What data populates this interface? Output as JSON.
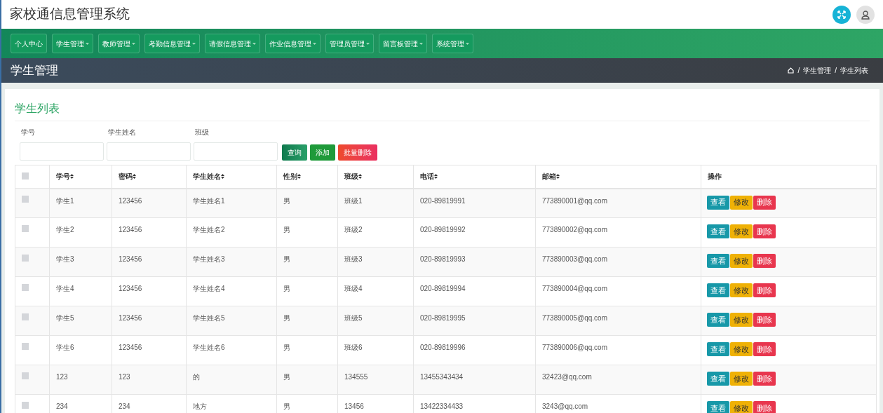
{
  "header": {
    "title": "家校通信息管理系统"
  },
  "nav": [
    {
      "label": "个人中心",
      "dropdown": false
    },
    {
      "label": "学生管理",
      "dropdown": true
    },
    {
      "label": "教师管理",
      "dropdown": true
    },
    {
      "label": "考勤信息管理",
      "dropdown": true
    },
    {
      "label": "请假信息管理",
      "dropdown": true
    },
    {
      "label": "作业信息管理",
      "dropdown": true
    },
    {
      "label": "管理员管理",
      "dropdown": true
    },
    {
      "label": "留言板管理",
      "dropdown": true
    },
    {
      "label": "系统管理",
      "dropdown": true
    }
  ],
  "page_bar": {
    "title": "学生管理",
    "breadcrumb": [
      {
        "separator": "/",
        "label": "学生管理"
      },
      {
        "separator": "/",
        "label": "学生列表"
      }
    ]
  },
  "panel": {
    "title": "学生列表"
  },
  "filters": [
    {
      "label": "学号"
    },
    {
      "label": "学生姓名"
    },
    {
      "label": "班级"
    }
  ],
  "filter_buttons": [
    {
      "label": "查询",
      "kind": "search"
    },
    {
      "label": "添加",
      "kind": "add"
    },
    {
      "label": "批量删除",
      "kind": "delete"
    }
  ],
  "table": {
    "header_checked": false,
    "columns": [
      {
        "label": "学号",
        "sortable": true
      },
      {
        "label": "密码",
        "sortable": true
      },
      {
        "label": "学生姓名",
        "sortable": true
      },
      {
        "label": "性别",
        "sortable": true
      },
      {
        "label": "班级",
        "sortable": true
      },
      {
        "label": "电话",
        "sortable": true
      },
      {
        "label": "邮箱",
        "sortable": true
      },
      {
        "label": "操作",
        "sortable": false
      }
    ],
    "rows": [
      {
        "checked": false,
        "cells": [
          "学生1",
          "123456",
          "学生姓名1",
          "男",
          "班级1",
          "020-89819991",
          "773890001@qq.com"
        ],
        "actions": [
          {
            "label": "查看",
            "kind": "view"
          },
          {
            "label": "修改",
            "kind": "edit"
          },
          {
            "label": "删除",
            "kind": "delete"
          }
        ]
      },
      {
        "checked": false,
        "cells": [
          "学生2",
          "123456",
          "学生姓名2",
          "男",
          "班级2",
          "020-89819992",
          "773890002@qq.com"
        ],
        "actions": [
          {
            "label": "查看",
            "kind": "view"
          },
          {
            "label": "修改",
            "kind": "edit"
          },
          {
            "label": "删除",
            "kind": "delete"
          }
        ]
      },
      {
        "checked": false,
        "cells": [
          "学生3",
          "123456",
          "学生姓名3",
          "男",
          "班级3",
          "020-89819993",
          "773890003@qq.com"
        ],
        "actions": [
          {
            "label": "查看",
            "kind": "view"
          },
          {
            "label": "修改",
            "kind": "edit"
          },
          {
            "label": "删除",
            "kind": "delete"
          }
        ]
      },
      {
        "checked": false,
        "cells": [
          "学生4",
          "123456",
          "学生姓名4",
          "男",
          "班级4",
          "020-89819994",
          "773890004@qq.com"
        ],
        "actions": [
          {
            "label": "查看",
            "kind": "view"
          },
          {
            "label": "修改",
            "kind": "edit"
          },
          {
            "label": "删除",
            "kind": "delete"
          }
        ]
      },
      {
        "checked": false,
        "cells": [
          "学生5",
          "123456",
          "学生姓名5",
          "男",
          "班级5",
          "020-89819995",
          "773890005@qq.com"
        ],
        "actions": [
          {
            "label": "查看",
            "kind": "view"
          },
          {
            "label": "修改",
            "kind": "edit"
          },
          {
            "label": "删除",
            "kind": "delete"
          }
        ]
      },
      {
        "checked": false,
        "cells": [
          "学生6",
          "123456",
          "学生姓名6",
          "男",
          "班级6",
          "020-89819996",
          "773890006@qq.com"
        ],
        "actions": [
          {
            "label": "查看",
            "kind": "view"
          },
          {
            "label": "修改",
            "kind": "edit"
          },
          {
            "label": "删除",
            "kind": "delete"
          }
        ]
      },
      {
        "checked": false,
        "cells": [
          "123",
          "123",
          "的",
          "男",
          "134555",
          "13455343434",
          "32423@qq.com"
        ],
        "actions": [
          {
            "label": "查看",
            "kind": "view"
          },
          {
            "label": "修改",
            "kind": "edit"
          },
          {
            "label": "删除",
            "kind": "delete"
          }
        ]
      },
      {
        "checked": false,
        "cells": [
          "234",
          "234",
          "地方",
          "男",
          "13456",
          "13422334433",
          "3243@qq.com"
        ],
        "actions": [
          {
            "label": "查看",
            "kind": "view"
          },
          {
            "label": "修改",
            "kind": "edit"
          },
          {
            "label": "删除",
            "kind": "delete"
          }
        ]
      }
    ]
  }
}
